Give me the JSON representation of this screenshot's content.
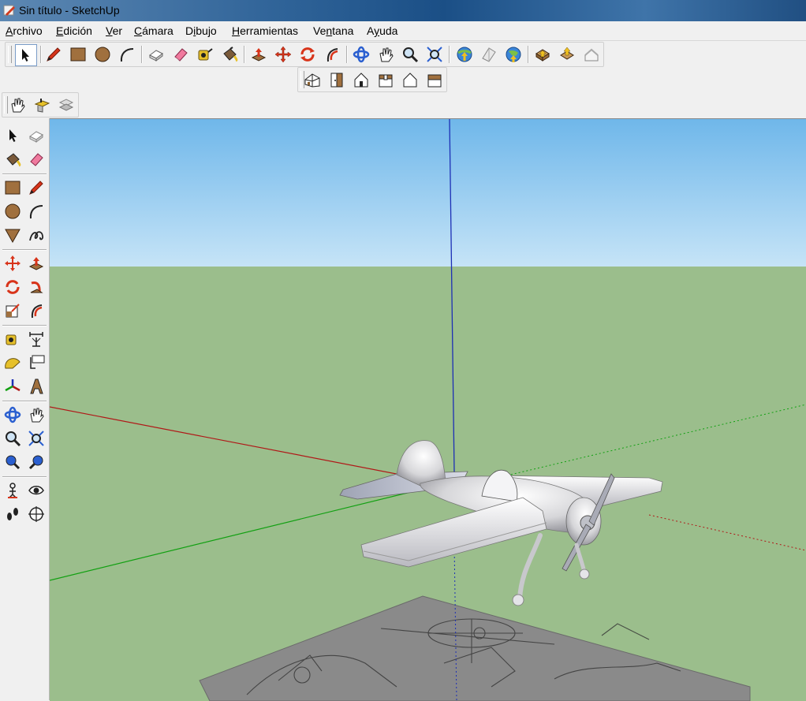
{
  "window": {
    "title": "Sin título - SketchUp"
  },
  "menubar": {
    "items": [
      {
        "key": "A",
        "rest": "rchivo"
      },
      {
        "key": "E",
        "rest": "dición"
      },
      {
        "key": "V",
        "rest": "er"
      },
      {
        "key": "C",
        "rest": "ámara"
      },
      {
        "pre": "D",
        "key": "i",
        "rest": "bujo"
      },
      {
        "key": "H",
        "rest": "erramientas"
      },
      {
        "pre": "Ve",
        "key": "n",
        "rest": "tana"
      },
      {
        "pre": "A",
        "key": "y",
        "rest": "uda"
      }
    ]
  },
  "toolbars": {
    "main": [
      "select",
      "pencil",
      "rectangle",
      "circle",
      "arc",
      "make-component",
      "eraser",
      "tape-measure",
      "paint-bucket",
      "push-pull",
      "move",
      "rotate",
      "follow-me",
      "orbit",
      "pan",
      "zoom",
      "zoom-extents",
      "get-models",
      "share-model",
      "google-earth",
      "get-current-view",
      "toggle-terrain",
      "place-model"
    ],
    "views": [
      "iso-view",
      "top-view",
      "front-view",
      "right-view",
      "back-view",
      "left-view"
    ],
    "sandbox": [
      "smoove",
      "stamp",
      "drape"
    ]
  },
  "colors": {
    "sky_top": "#6fb7ea",
    "sky_bottom": "#bfe0f6",
    "ground": "#9bbe8c",
    "axis_blue": "#1d2fb5",
    "axis_red": "#b01818",
    "axis_green": "#12a012"
  }
}
